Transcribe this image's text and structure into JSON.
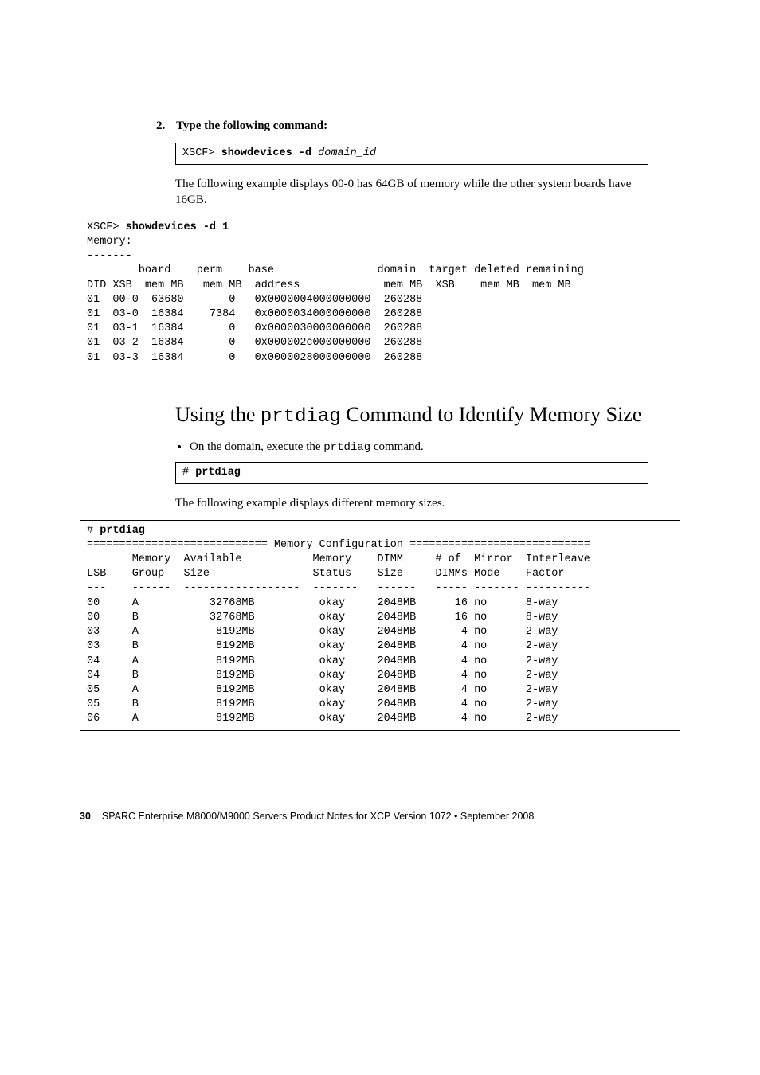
{
  "step": {
    "number": "2.",
    "instruction": "Type the following command:"
  },
  "cmdbox1": {
    "prompt": "XSCF> ",
    "cmd": "showdevices -d ",
    "arg": "domain_id"
  },
  "para1": "The following example displays 00-0 has 64GB of memory while the other system boards have 16GB.",
  "cmdbox2": {
    "line1_prompt": "XSCF> ",
    "line1_cmd": "showdevices -d 1",
    "body": "Memory:\n-------\n        board    perm    base                domain  target deleted remaining\nDID XSB  mem MB   mem MB  address             mem MB  XSB    mem MB  mem MB\n01  00-0  63680       0   0x0000004000000000  260288\n01  03-0  16384    7384   0x0000034000000000  260288\n01  03-1  16384       0   0x0000030000000000  260288\n01  03-2  16384       0   0x000002c000000000  260288\n01  03-3  16384       0   0x0000028000000000  260288\n"
  },
  "section_title_pre": "Using the ",
  "section_title_code": "prtdiag",
  "section_title_post": " Command to Identify Memory Size",
  "bullet_text_pre": "On the domain, execute the ",
  "bullet_code": "prtdiag",
  "bullet_text_post": " command.",
  "cmdbox3": {
    "prompt": "# ",
    "cmd": "prtdiag"
  },
  "para2": "The following example displays different memory sizes.",
  "cmdbox4": {
    "line1_prompt": "# ",
    "line1_cmd": "prtdiag",
    "body": "============================ Memory Configuration ============================\n       Memory  Available           Memory    DIMM     # of  Mirror  Interleave\nLSB    Group   Size                Status    Size     DIMMs Mode    Factor\n---    ------  ------------------  -------   ------   ----- ------- ----------\n00     A           32768MB          okay     2048MB      16 no      8-way\n00     B           32768MB          okay     2048MB      16 no      8-way\n03     A            8192MB          okay     2048MB       4 no      2-way\n03     B            8192MB          okay     2048MB       4 no      2-way\n04     A            8192MB          okay     2048MB       4 no      2-way\n04     B            8192MB          okay     2048MB       4 no      2-way\n05     A            8192MB          okay     2048MB       4 no      2-way\n05     B            8192MB          okay     2048MB       4 no      2-way\n06     A            8192MB          okay     2048MB       4 no      2-way"
  },
  "footer": {
    "page": "30",
    "text": "SPARC Enterprise M8000/M9000 Servers Product Notes for XCP Version 1072 • September 2008"
  }
}
